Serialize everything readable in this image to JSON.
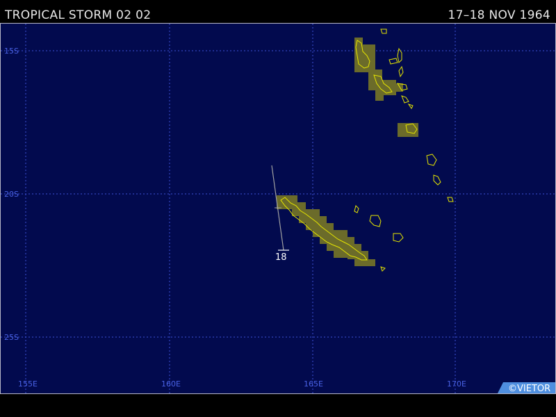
{
  "header": {
    "title": "TROPICAL STORM 02 02",
    "dates": "17–18 NOV 1964"
  },
  "map": {
    "lat_labels": [
      "15S",
      "20S",
      "25S"
    ],
    "lon_labels": [
      "155E",
      "160E",
      "165E",
      "170E"
    ],
    "track_day_label": "18",
    "credit": "©VIETOR",
    "colors": {
      "ocean": "#020a4e",
      "grid": "#3d52d8",
      "land_fill": "#6b6b2a",
      "coast": "#e6e600",
      "track": "#a0a0a0"
    }
  }
}
